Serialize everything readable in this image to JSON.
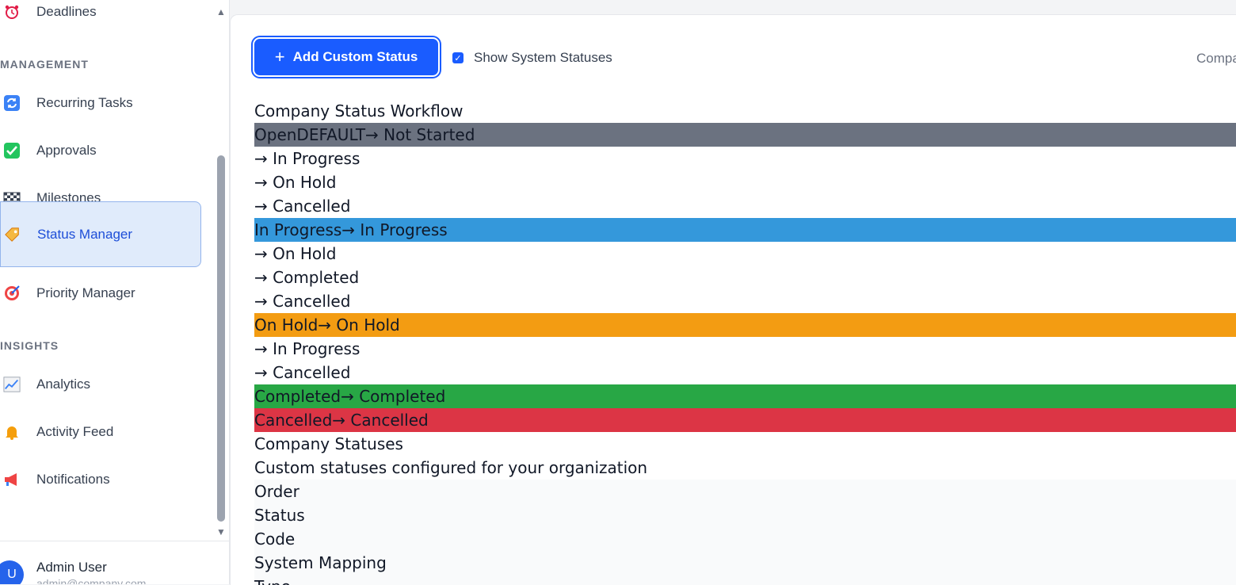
{
  "sidebar": {
    "top_item": "Deadlines",
    "sections": [
      {
        "title": "MANAGEMENT"
      },
      {
        "title": "INSIGHTS"
      }
    ],
    "items": [
      {
        "label": "Recurring Tasks",
        "icon": "recurring-icon"
      },
      {
        "label": "Approvals",
        "icon": "check-icon"
      },
      {
        "label": "Milestones",
        "icon": "checkered-flag-icon"
      },
      {
        "label": "Status Manager",
        "icon": "tag-icon"
      },
      {
        "label": "Priority Manager",
        "icon": "target-icon"
      },
      {
        "label": "Analytics",
        "icon": "chart-icon"
      },
      {
        "label": "Activity Feed",
        "icon": "bell-icon"
      },
      {
        "label": "Notifications",
        "icon": "megaphone-icon"
      }
    ],
    "active_item": "Status Manager",
    "user": {
      "initial": "U",
      "name": "Admin User",
      "email": "admin@company.com"
    }
  },
  "toolbar": {
    "add_button_label": "Add Custom Status",
    "show_system_label": "Show System Statuses",
    "show_system_checked": true,
    "right_text": "Compa"
  },
  "workflow_rows": [
    {
      "text": "Company Status Workflow",
      "style": "plain"
    },
    {
      "text": "OpenDEFAULT→ Not Started",
      "style": "gray"
    },
    {
      "text": "→ In Progress",
      "style": "plain"
    },
    {
      "text": "→ On Hold",
      "style": "plain"
    },
    {
      "text": "→ Cancelled",
      "style": "plain"
    },
    {
      "text": "In Progress→ In Progress",
      "style": "blue"
    },
    {
      "text": "→ On Hold",
      "style": "plain"
    },
    {
      "text": "→ Completed",
      "style": "plain"
    },
    {
      "text": "→ Cancelled",
      "style": "plain"
    },
    {
      "text": "On Hold→ On Hold",
      "style": "orange"
    },
    {
      "text": "→ In Progress",
      "style": "plain"
    },
    {
      "text": "→ Cancelled",
      "style": "plain"
    },
    {
      "text": "Completed→ Completed",
      "style": "green"
    },
    {
      "text": "Cancelled→ Cancelled",
      "style": "red"
    },
    {
      "text": "Company Statuses",
      "style": "plain"
    },
    {
      "text": "Custom statuses configured for your organization",
      "style": "plain"
    },
    {
      "text": "Order",
      "style": "light"
    },
    {
      "text": "Status",
      "style": "light"
    },
    {
      "text": "Code",
      "style": "light"
    },
    {
      "text": "System Mapping",
      "style": "light"
    },
    {
      "text": "Type",
      "style": "light"
    }
  ],
  "colors": {
    "accent": "#1a5cff",
    "not_started": "#6b7280",
    "in_progress": "#3498db",
    "on_hold": "#f39c12",
    "completed": "#28a745",
    "cancelled": "#dc3545"
  }
}
